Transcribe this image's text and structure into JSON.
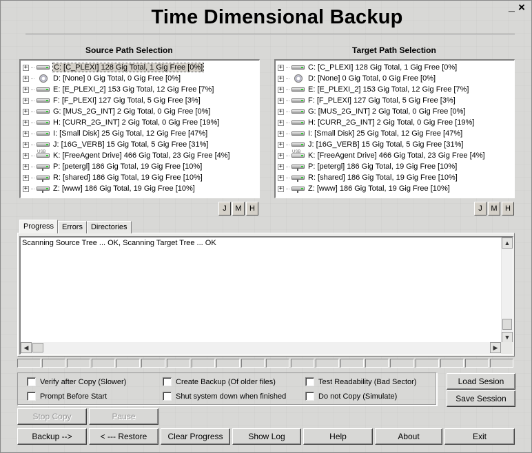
{
  "window": {
    "title": "Time Dimensional Backup",
    "minimize_label": "_",
    "close_label": "×"
  },
  "source": {
    "heading": "Source Path Selection",
    "drives": [
      {
        "label": "C: [C_PLEXI] 128 Gig Total, 1 Gig Free [0%]",
        "icon": "hard-drive-icon",
        "selected": true
      },
      {
        "label": "D: [None] 0 Gig Total, 0 Gig Free [0%]",
        "icon": "cd-drive-icon"
      },
      {
        "label": "E: [E_PLEXI_2] 153 Gig Total, 12 Gig Free [7%]",
        "icon": "hard-drive-icon"
      },
      {
        "label": "F: [F_PLEXI] 127 Gig Total, 5 Gig Free [3%]",
        "icon": "hard-drive-icon"
      },
      {
        "label": "G: [MUS_2G_INT] 2 Gig Total, 0 Gig Free [0%]",
        "icon": "hard-drive-icon"
      },
      {
        "label": "H: [CURR_2G_INT] 2 Gig Total, 0 Gig Free [19%]",
        "icon": "hard-drive-icon"
      },
      {
        "label": "I: [Small Disk] 25 Gig Total, 12 Gig Free [47%]",
        "icon": "hard-drive-icon"
      },
      {
        "label": "J: [16G_VERB] 15 Gig Total, 5 Gig Free [31%]",
        "icon": "hard-drive-icon"
      },
      {
        "label": "K: [FreeAgent Drive] 466 Gig Total, 23 Gig Free [4%]",
        "icon": "usb-drive-icon"
      },
      {
        "label": "P: [petergl] 186 Gig Total, 19 Gig Free [10%]",
        "icon": "network-drive-icon"
      },
      {
        "label": "R: [shared] 186 Gig Total, 19 Gig Free [10%]",
        "icon": "network-drive-icon"
      },
      {
        "label": "Z: [www] 186 Gig Total, 19 Gig Free [10%]",
        "icon": "network-drive-icon"
      }
    ],
    "buttons": [
      "J",
      "M",
      "H"
    ]
  },
  "target": {
    "heading": "Target Path Selection",
    "drives": [
      {
        "label": "C: [C_PLEXI] 128 Gig Total, 1 Gig Free [0%]",
        "icon": "hard-drive-icon"
      },
      {
        "label": "D: [None] 0 Gig Total, 0 Gig Free [0%]",
        "icon": "cd-drive-icon"
      },
      {
        "label": "E: [E_PLEXI_2] 153 Gig Total, 12 Gig Free [7%]",
        "icon": "hard-drive-icon"
      },
      {
        "label": "F: [F_PLEXI] 127 Gig Total, 5 Gig Free [3%]",
        "icon": "hard-drive-icon"
      },
      {
        "label": "G: [MUS_2G_INT] 2 Gig Total, 0 Gig Free [0%]",
        "icon": "hard-drive-icon"
      },
      {
        "label": "H: [CURR_2G_INT] 2 Gig Total, 0 Gig Free [19%]",
        "icon": "hard-drive-icon"
      },
      {
        "label": "I: [Small Disk] 25 Gig Total, 12 Gig Free [47%]",
        "icon": "hard-drive-icon"
      },
      {
        "label": "J: [16G_VERB] 15 Gig Total, 5 Gig Free [31%]",
        "icon": "hard-drive-icon"
      },
      {
        "label": "K: [FreeAgent Drive] 466 Gig Total, 23 Gig Free [4%]",
        "icon": "usb-drive-icon"
      },
      {
        "label": "P: [petergl] 186 Gig Total, 19 Gig Free [10%]",
        "icon": "network-drive-icon"
      },
      {
        "label": "R: [shared] 186 Gig Total, 19 Gig Free [10%]",
        "icon": "network-drive-icon"
      },
      {
        "label": "Z: [www] 186 Gig Total, 19 Gig Free [10%]",
        "icon": "network-drive-icon"
      }
    ],
    "buttons": [
      "J",
      "M",
      "H"
    ]
  },
  "tabs": [
    {
      "label": "Progress",
      "active": true
    },
    {
      "label": "Errors",
      "active": false
    },
    {
      "label": "Directories",
      "active": false
    }
  ],
  "log": {
    "text": "Scanning Source Tree ... OK, Scanning  Target Tree ... OK"
  },
  "progress": {
    "segments": 20,
    "value": 0
  },
  "options": {
    "verify_after_copy": "Verify after Copy (Slower)",
    "create_backup": "Create Backup (Of older files)",
    "test_readability": "Test Readability (Bad Sector)",
    "prompt_before_start": "Prompt Before Start",
    "shutdown_when_finished": "Shut system down when finished",
    "do_not_copy": "Do not Copy (Simulate)"
  },
  "session": {
    "load_label": "Load Sesion",
    "save_label": "Save Session"
  },
  "controls": {
    "stop_copy": "Stop Copy",
    "pause": "Pause"
  },
  "actions": {
    "backup": "Backup -->",
    "restore": "< --- Restore",
    "clear_progress": "Clear Progress",
    "show_log": "Show Log",
    "help": "Help",
    "about": "About",
    "exit": "Exit"
  }
}
